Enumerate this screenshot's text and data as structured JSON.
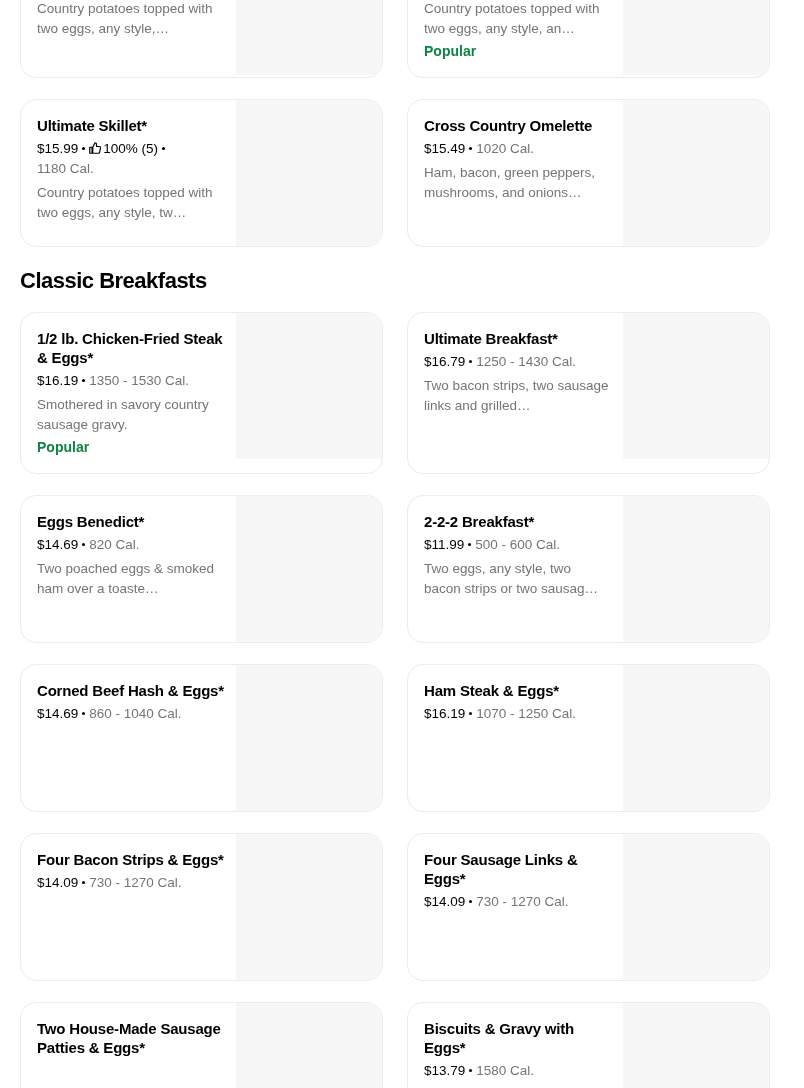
{
  "sections": [
    {
      "items": [
        {
          "description": "Country potatoes topped with two eggs, any style,…"
        },
        {
          "description": "Country potatoes topped with two eggs, any style, an…",
          "tag": "Popular"
        },
        {
          "title": "Ultimate Skillet*",
          "price": "$15.99",
          "rating": "100% (5)",
          "calories": "1180 Cal.",
          "description": "Country potatoes topped with two eggs, any style, tw…"
        },
        {
          "title": "Cross Country Omelette",
          "price": "$15.49",
          "calories": "1020 Cal.",
          "description": "Ham, bacon, green peppers, mushrooms, and onions…"
        }
      ]
    },
    {
      "title": "Classic Breakfasts",
      "items": [
        {
          "title": "1/2 lb. Chicken-Fried Steak & Eggs*",
          "price": "$16.19",
          "calories": "1350 - 1530 Cal.",
          "description": "Smothered in savory country sausage gravy.",
          "tag": "Popular"
        },
        {
          "title": "Ultimate Breakfast*",
          "price": "$16.79",
          "calories": "1250 - 1430 Cal.",
          "description": "Two bacon strips, two sausage links and grilled…"
        },
        {
          "title": "Eggs Benedict*",
          "price": "$14.69",
          "calories": "820 Cal.",
          "description": "Two poached eggs & smoked ham over a toaste…"
        },
        {
          "title": "2-2-2 Breakfast*",
          "price": "$11.99",
          "calories": "500 - 600 Cal.",
          "description": "Two eggs, any style, two bacon strips or two sausag…"
        },
        {
          "title": "Corned Beef Hash & Eggs*",
          "price": "$14.69",
          "calories": "860 - 1040 Cal."
        },
        {
          "title": "Ham Steak & Eggs*",
          "price": "$16.19",
          "calories": "1070 - 1250 Cal."
        },
        {
          "title": "Four Bacon Strips & Eggs*",
          "price": "$14.09",
          "calories": "730 - 1270 Cal."
        },
        {
          "title": "Four Sausage Links & Eggs*",
          "price": "$14.09",
          "calories": "730 - 1270 Cal."
        },
        {
          "title": "Two House-Made Sausage Patties & Eggs*"
        },
        {
          "title": "Biscuits & Gravy with Eggs*",
          "price": "$13.79",
          "calories": "1580 Cal."
        }
      ]
    }
  ]
}
